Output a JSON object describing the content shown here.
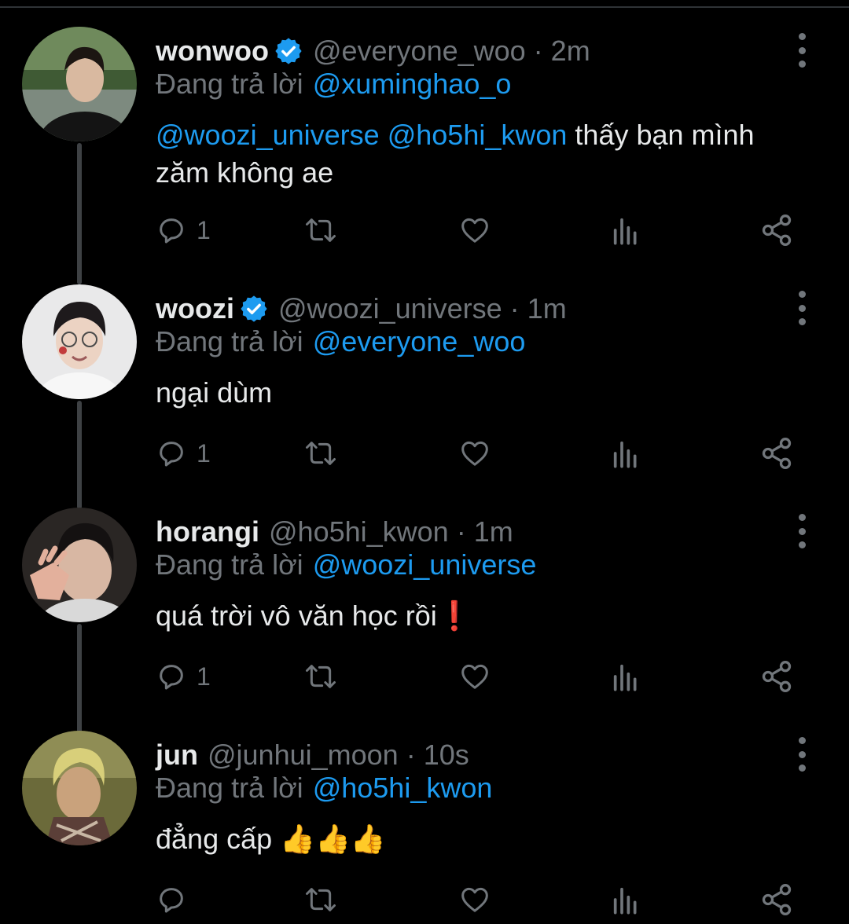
{
  "tweets": [
    {
      "name": "wonwoo",
      "verified": true,
      "handle": "@everyone_woo",
      "dot": "·",
      "time": "2m",
      "reply_label": "Đang trả lời",
      "reply_to": "@xuminghao_o",
      "mention1": "@woozi_universe",
      "mention2": "@ho5hi_kwon",
      "text_line1": "thấy bạn mình",
      "text_line2": "zăm không ae",
      "reply_count": "1",
      "avatar": "wonwoo-avatar"
    },
    {
      "name": "woozi",
      "verified": true,
      "handle": "@woozi_universe",
      "dot": "·",
      "time": "1m",
      "reply_label": "Đang trả lời",
      "reply_to": "@everyone_woo",
      "text": "ngại dùm",
      "reply_count": "1",
      "avatar": "woozi-avatar"
    },
    {
      "name": "horangi",
      "verified": false,
      "handle": "@ho5hi_kwon",
      "dot": "·",
      "time": "1m",
      "reply_label": "Đang trả lời",
      "reply_to": "@woozi_universe",
      "text": "quá trời vô văn học rồi",
      "emoji": "❗",
      "reply_count": "1",
      "avatar": "horangi-avatar"
    },
    {
      "name": "jun",
      "verified": false,
      "handle": "@junhui_moon",
      "dot": "·",
      "time": "10s",
      "reply_label": "Đang trả lời",
      "reply_to": "@ho5hi_kwon",
      "text": "đẳng cấp",
      "emoji": "👍👍👍",
      "reply_count": "",
      "avatar": "jun-avatar"
    }
  ],
  "icons": {
    "reply": "reply-icon",
    "retweet": "retweet-icon",
    "like": "heart-icon",
    "views": "views-icon",
    "share": "share-icon",
    "more": "more-vertical-icon",
    "verified": "verified-badge-icon"
  },
  "colors": {
    "background": "#000000",
    "text": "#e7e9ea",
    "muted": "#71767b",
    "link": "#1d9bf0",
    "verified": "#1d9bf0",
    "thread_line": "#3e4144"
  }
}
